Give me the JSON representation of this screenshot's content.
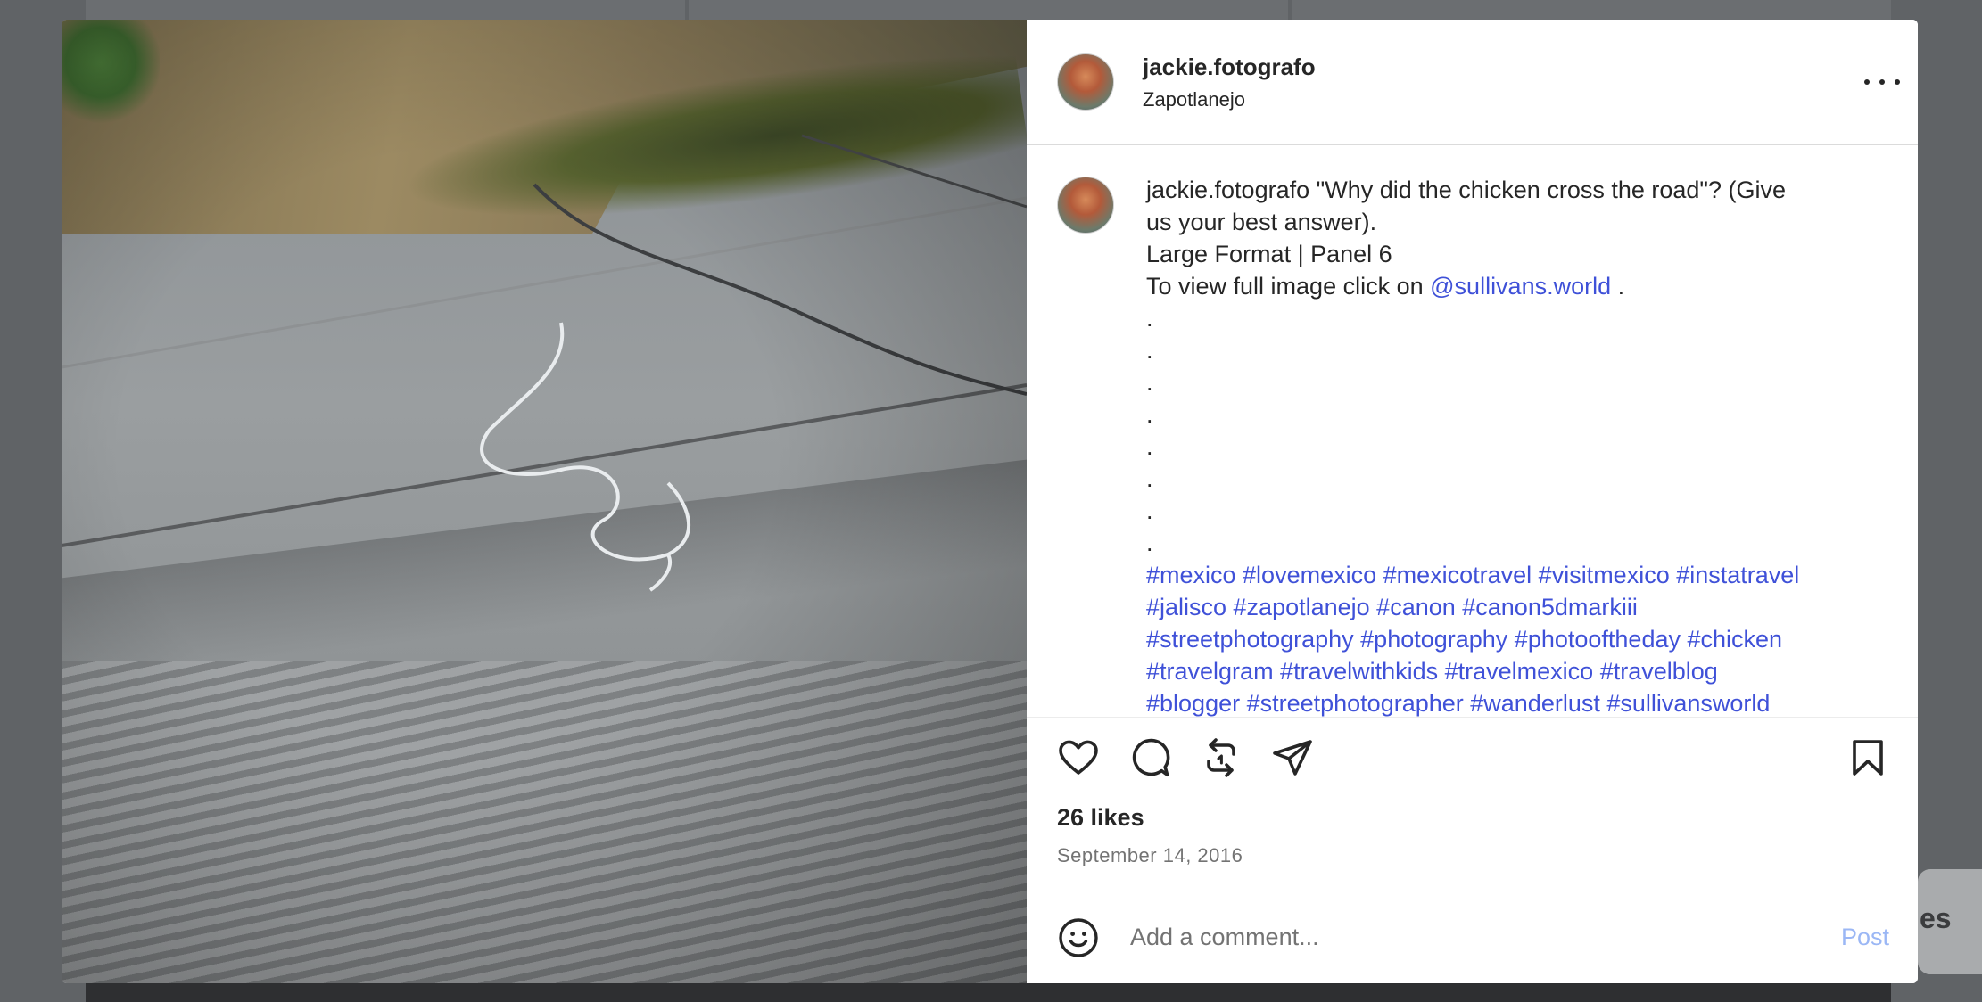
{
  "post": {
    "username": "jackie.fotografo",
    "location": "Zapotlanejo",
    "caption_lines": [
      "\"Why did the chicken cross the road\"? (Give",
      "us your best answer).",
      "Large Format | Panel 6"
    ],
    "link_prefix": "To view full image click on",
    "link_mention": "@sullivans.world",
    "link_suffix": ".",
    "dots": [
      ".",
      ".",
      ".",
      ".",
      ".",
      ".",
      ".",
      "."
    ],
    "hashtag_lines": [
      "#mexico #lovemexico #mexicotravel #visitmexico #instatravel",
      "#jalisco #zapotlanejo #canon #canon5dmarkiii",
      "#streetphotography #photography #photooftheday #chicken",
      "#travelgram #travelwithkids #travelmexico #travelblog",
      "#blogger #streetphotographer #wanderlust #sullivansworld"
    ],
    "likes": "26 likes",
    "date": "September 14, 2016"
  },
  "comment_box": {
    "placeholder": "Add a comment...",
    "post_label": "Post"
  },
  "background": {
    "peek_text": "es"
  },
  "icons": {
    "more": "more-options-icon",
    "like": "heart-icon",
    "comment": "comment-bubble-icon",
    "repost": "repost-icon",
    "share": "paper-plane-icon",
    "save": "bookmark-icon",
    "emoji": "smiley-icon"
  },
  "colors": {
    "link": "#3f51d8",
    "post_button": "#9bb7f5",
    "secondary_text": "#737373"
  }
}
